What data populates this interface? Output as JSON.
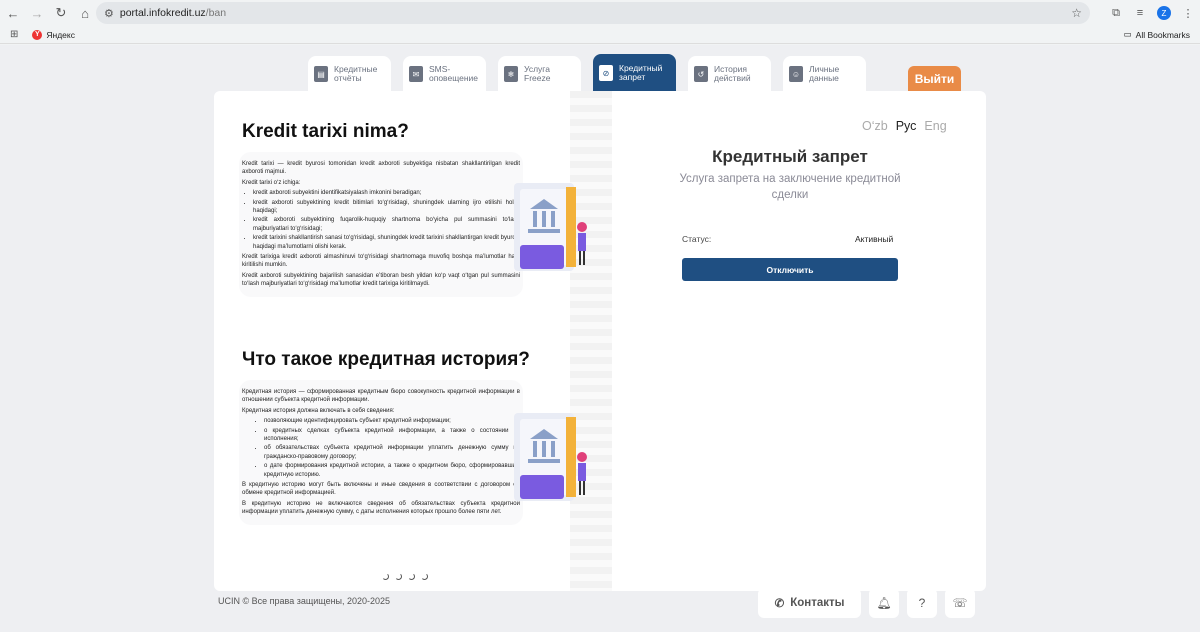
{
  "browser": {
    "url_host": "portal.infokredit.uz",
    "url_path": "/ban",
    "profile_initial": "Z"
  },
  "bookmarks": {
    "yandex": "Яндекс",
    "all": "All Bookmarks"
  },
  "tabs": [
    {
      "line1": "Кредитные",
      "line2": "отчёты",
      "icon": "report-icon"
    },
    {
      "line1": "SMS-",
      "line2": "оповещение",
      "icon": "sms-icon"
    },
    {
      "line1": "Услуга",
      "line2": "Freeze",
      "icon": "freeze-icon"
    },
    {
      "line1": "Кредитный",
      "line2": "запрет",
      "icon": "ban-icon"
    },
    {
      "line1": "История",
      "line2": "действий",
      "icon": "history-icon"
    },
    {
      "line1": "Личные",
      "line2": "данные",
      "icon": "person-icon"
    }
  ],
  "logout": "Выйти",
  "uz": {
    "title": "Kredit tarixi nima?",
    "p1": "Kredit tarixi — kredit byurosi tomonidan kredit axboroti subyektiga nisbatan shakllantirilgan kredit axboroti majmui.",
    "p2": "Kredit tarixi o‘z ichiga:",
    "items": [
      "kredit axboroti subyektini identifikatsiyalash imkonini beradigan;",
      "kredit axboroti subyektining kredit bitimlari to‘g‘risidagi, shuningdek ularning ijro etilishi holati haqidagi;",
      "kredit axboroti subyektining fuqarolik-huquqiy shartnoma bo‘yicha pul summasini to‘lash majburiyatlari to‘g‘risidagi;",
      "kredit tarixini shakllantirish sanasi to‘g‘risidagi, shuningdek kredit tarixini shakllantirgan kredit byurosi haqidagi ma’lumotlarni olishi kerak."
    ],
    "p3": "Kredit tarixiga kredit axboroti almashinuvi to‘g‘risidagi shartnomaga muvofiq boshqa ma’lumotlar ham kiritilishi mumkin.",
    "p4": "Kredit axboroti subyektining bajarilish sanasidan e’tiboran besh yildan ko‘p vaqt o‘tgan pul summasini to‘lash majburiyatlari to‘g‘risidagi ma’lumotlar kredit tarixiga kiritilmaydi."
  },
  "ru": {
    "title": "Что такое кредитная история?",
    "p1": "Кредитная история — сформированная кредитным бюро совокупность кредитной информации в отношении субъекта кредитной информации.",
    "p2": "Кредитная история должна включать в себя сведения:",
    "items": [
      "позволяющие идентифицировать субъект кредитной информации;",
      "о кредитных сделках субъекта кредитной информации, а также о состоянии их исполнения;",
      "об обязательствах субъекта кредитной информации уплатить денежную сумму по гражданско-правовому договору;",
      "о дате формирования кредитной истории, а также о кредитном бюро, сформировавшим кредитную историю."
    ],
    "p3": "В кредитную историю могут быть включены и иные сведения в соответствии с договором об обмене кредитной информацией.",
    "p4": "В кредитную историю не включаются сведения об обязательствах субъекта кредитной информации уплатить денежную сумму, с даты исполнения которых прошло более пяти лет."
  },
  "langs": {
    "uz": "O‘zb",
    "ru": "Рус",
    "en": "Eng"
  },
  "panel": {
    "title": "Кредитный запрет",
    "subtitle": "Услуга запрета на заключение кредитной сделки",
    "status_label": "Статус:",
    "status_value": "Активный",
    "button": "Отключить"
  },
  "footer": {
    "copyright": "UCIN © Все права защищены, 2020-2025",
    "contacts": "Контакты"
  },
  "colors": {
    "primary": "#1f4f82",
    "logout": "#e98b47"
  }
}
